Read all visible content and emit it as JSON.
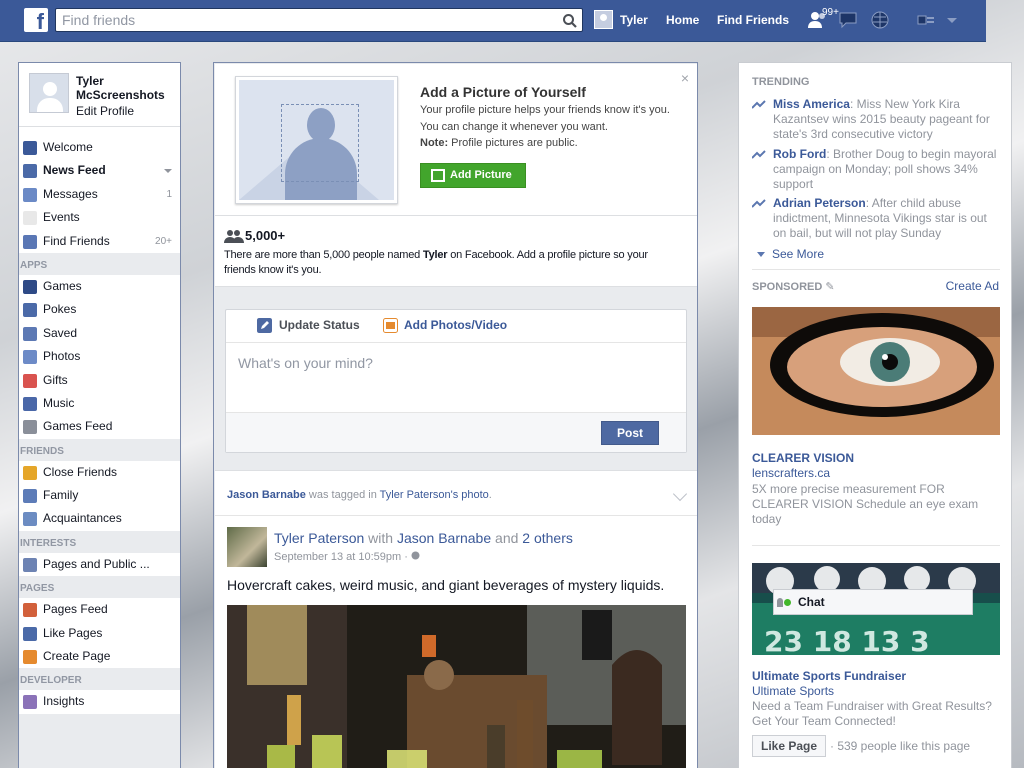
{
  "topbar": {
    "search_placeholder": "Find friends",
    "user_name": "Tyler",
    "home_label": "Home",
    "find_friends_label": "Find Friends",
    "friend_requests_badge": "99+"
  },
  "left": {
    "profile_name": "Tyler McScreenshots",
    "edit_profile": "Edit Profile",
    "favorites": [
      {
        "label": "Welcome",
        "icon": "facebook-icon",
        "color": "#3b5998"
      },
      {
        "label": "News Feed",
        "icon": "news-feed-icon",
        "color": "#4b6aa8",
        "bold": true
      },
      {
        "label": "Messages",
        "icon": "messages-icon",
        "color": "#6b8ac6",
        "count": "1"
      },
      {
        "label": "Events",
        "icon": "calendar-icon",
        "color": "#e8e8e8",
        "count": ""
      },
      {
        "label": "Find Friends",
        "icon": "find-friends-icon",
        "color": "#5a77b5",
        "count": "20+"
      }
    ],
    "apps_title": "APPS",
    "apps": [
      {
        "label": "Games",
        "icon": "games-icon",
        "color": "#2e4a86"
      },
      {
        "label": "Pokes",
        "icon": "pokes-icon",
        "color": "#4b6aa8"
      },
      {
        "label": "Saved",
        "icon": "saved-icon",
        "color": "#5d79b4"
      },
      {
        "label": "Photos",
        "icon": "photos-icon",
        "color": "#6d8bc7"
      },
      {
        "label": "Gifts",
        "icon": "gifts-icon",
        "color": "#d9534f"
      },
      {
        "label": "Music",
        "icon": "music-icon",
        "color": "#4a67a8"
      },
      {
        "label": "Games Feed",
        "icon": "games-feed-icon",
        "color": "#8a8f99"
      }
    ],
    "friends_title": "FRIENDS",
    "friends": [
      {
        "label": "Close Friends",
        "icon": "star-icon",
        "color": "#e5a629"
      },
      {
        "label": "Family",
        "icon": "family-icon",
        "color": "#5d7cb8"
      },
      {
        "label": "Acquaintances",
        "icon": "acquaintances-icon",
        "color": "#6c8cc2"
      }
    ],
    "interests_title": "INTERESTS",
    "interests": [
      {
        "label": "Pages and Public ...",
        "icon": "pages-list-icon",
        "color": "#6d83b3"
      }
    ],
    "pages_title": "PAGES",
    "pages": [
      {
        "label": "Pages Feed",
        "icon": "flag-icon",
        "color": "#d2603b"
      },
      {
        "label": "Like Pages",
        "icon": "thumbs-up-icon",
        "color": "#4b6aa8"
      },
      {
        "label": "Create Page",
        "icon": "create-page-icon",
        "color": "#e58a2e"
      }
    ],
    "developer_title": "DEVELOPER",
    "developer": [
      {
        "label": "Insights",
        "icon": "insights-icon",
        "color": "#8b72b8"
      }
    ]
  },
  "center": {
    "addpic_title": "Add a Picture of Yourself",
    "addpic_body": "Your profile picture helps your friends know it's you. You can change it whenever you want.",
    "addpic_note_label": "Note:",
    "addpic_note_text": " Profile pictures are public.",
    "addpic_button": "Add Picture",
    "close": "×",
    "fivek_title": "5,000+",
    "fivek_pre": "There are more than 5,000 people named ",
    "fivek_name": "Tyler",
    "fivek_post": " on Facebook. Add a profile picture so your friends know it's you.",
    "composer": {
      "tab_status": "Update Status",
      "tab_photos": "Add Photos/Video",
      "placeholder": "What's on your mind?",
      "post": "Post"
    },
    "story": {
      "tagged_name": "Jason Barnabe",
      "tagged_mid": " was tagged in ",
      "tagged_owner": "Tyler Paterson's",
      "tagged_space": " ",
      "tagged_photo": "photo",
      "tagged_end": ".",
      "author": "Tyler Paterson",
      "with": " with ",
      "with_name": "Jason Barnabe",
      "and": " and ",
      "others": "2 others",
      "time": "September 13 at 10:59pm · ",
      "text": "Hovercraft cakes, weird music, and giant beverages of mystery liquids."
    }
  },
  "right": {
    "trending_title": "TRENDING",
    "trending": [
      {
        "topic": "Miss America",
        "text": ": Miss New York Kira Kazantsev wins 2015 beauty pageant for state's 3rd consecutive victory"
      },
      {
        "topic": "Rob Ford",
        "text": ": Brother Doug to begin mayoral campaign on Monday; poll shows 34% support"
      },
      {
        "topic": "Adrian Peterson",
        "text": ": After child abuse indictment, Minnesota Vikings star is out on bail, but will not play Sunday"
      }
    ],
    "see_more": "See More",
    "sponsored_title": "SPONSORED",
    "create_ad": "Create Ad",
    "ad1": {
      "title": "CLEARER VISION",
      "link": "lenscrafters.ca",
      "desc": "5X more precise measurement FOR CLEARER VISION Schedule an eye exam today"
    },
    "chat_label": "Chat",
    "ad2": {
      "title": "Ultimate Sports Fundraiser",
      "link": "Ultimate Sports",
      "desc": "Need a Team Fundraiser with Great Results? Get Your Team Connected!",
      "like_button": "Like Page",
      "like_count": "· 539 people like this page"
    }
  }
}
